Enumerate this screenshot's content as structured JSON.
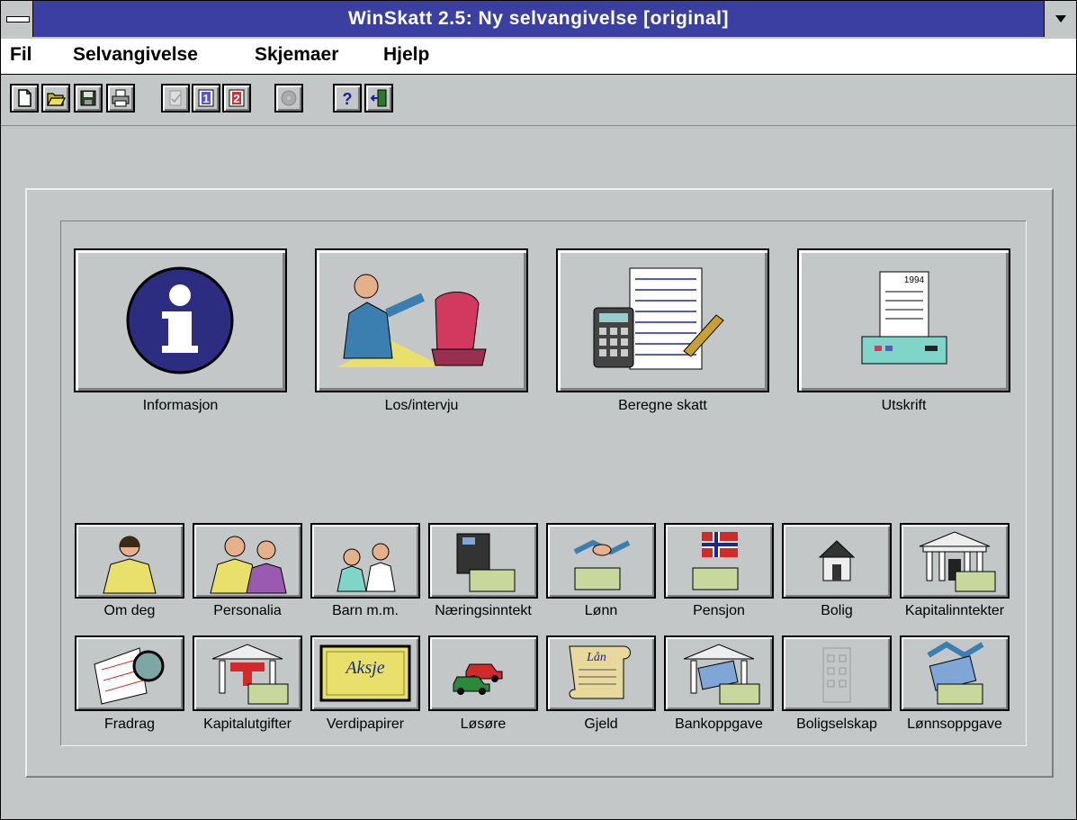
{
  "window": {
    "title": "WinSkatt 2.5:  Ny selvangivelse  [original]"
  },
  "menu": [
    {
      "label": "Fil"
    },
    {
      "label": "Selvangivelse"
    },
    {
      "label": "Skjemaer"
    },
    {
      "label": "Hjelp"
    }
  ],
  "toolbar": [
    "new-icon",
    "open-icon",
    "save-icon",
    "print-icon",
    "check-icon",
    "form1-icon",
    "form2-icon",
    "disk-icon",
    "help-icon",
    "exit-icon"
  ],
  "main_buttons": [
    {
      "label": "Informasjon",
      "icon": "info-icon"
    },
    {
      "label": "Los/intervju",
      "icon": "interview-icon"
    },
    {
      "label": "Beregne skatt",
      "icon": "calculator-icon"
    },
    {
      "label": "Utskrift",
      "icon": "printer-icon"
    }
  ],
  "category_row1": [
    {
      "label": "Om deg"
    },
    {
      "label": "Personalia"
    },
    {
      "label": "Barn m.m."
    },
    {
      "label": "Næringsinntekt"
    },
    {
      "label": "Lønn"
    },
    {
      "label": "Pensjon"
    },
    {
      "label": "Bolig"
    },
    {
      "label": "Kapitalinntekter"
    }
  ],
  "category_row2": [
    {
      "label": "Fradrag"
    },
    {
      "label": "Kapitalutgifter"
    },
    {
      "label": "Verdipapirer"
    },
    {
      "label": "Løsøre"
    },
    {
      "label": "Gjeld"
    },
    {
      "label": "Bankoppgave"
    },
    {
      "label": "Boligselskap"
    },
    {
      "label": "Lønnsoppgave"
    }
  ],
  "icon_text": {
    "aksje": "Aksje",
    "laan": "Lån",
    "year": "1994",
    "one": "1",
    "two": "2",
    "q": "?"
  },
  "colors": {
    "title_bar": "#3b3fa2",
    "face": "#c3c7c8"
  }
}
